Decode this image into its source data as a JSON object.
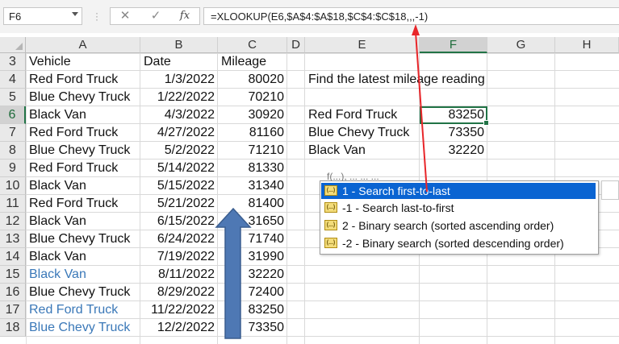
{
  "formula_bar": {
    "name_box": "F6",
    "cancel_icon": "✕",
    "enter_icon": "✓",
    "fx_label": "fx",
    "formula": "=XLOOKUP(E6,$A$4:$A$18,$C$4:$C$18,,,-1)"
  },
  "columns": [
    "A",
    "B",
    "C",
    "D",
    "E",
    "F",
    "G",
    "H"
  ],
  "selected_column": "F",
  "selected_row": "6",
  "rows": [
    {
      "n": "3",
      "a": "Vehicle",
      "b": "Date",
      "c": "Mileage",
      "e": "",
      "f": ""
    },
    {
      "n": "4",
      "a": "Red Ford Truck",
      "b": "1/3/2022",
      "c": "80020",
      "e": "Find the latest mileage reading",
      "f": ""
    },
    {
      "n": "5",
      "a": "Blue Chevy Truck",
      "b": "1/22/2022",
      "c": "70210",
      "e": "",
      "f": ""
    },
    {
      "n": "6",
      "a": "Black Van",
      "b": "4/3/2022",
      "c": "30920",
      "e": "Red Ford Truck",
      "f": "83250"
    },
    {
      "n": "7",
      "a": "Red Ford Truck",
      "b": "4/27/2022",
      "c": "81160",
      "e": "Blue Chevy Truck",
      "f": "73350"
    },
    {
      "n": "8",
      "a": "Blue Chevy Truck",
      "b": "5/2/2022",
      "c": "71210",
      "e": "Black Van",
      "f": "32220"
    },
    {
      "n": "9",
      "a": "Red Ford Truck",
      "b": "5/14/2022",
      "c": "81330",
      "e": "",
      "f": ""
    },
    {
      "n": "10",
      "a": "Black Van",
      "b": "5/15/2022",
      "c": "31340",
      "e": "",
      "f": ""
    },
    {
      "n": "11",
      "a": "Red Ford Truck",
      "b": "5/21/2022",
      "c": "81400",
      "e": "",
      "f": ""
    },
    {
      "n": "12",
      "a": "Black Van",
      "b": "6/15/2022",
      "c": "31650",
      "e": "",
      "f": ""
    },
    {
      "n": "13",
      "a": "Blue Chevy Truck",
      "b": "6/24/2022",
      "c": "71740",
      "e": "",
      "f": ""
    },
    {
      "n": "14",
      "a": "Black Van",
      "b": "7/19/2022",
      "c": "31990",
      "e": "",
      "f": ""
    },
    {
      "n": "15",
      "a": "Black Van",
      "b": "8/11/2022",
      "c": "32220",
      "e": "",
      "f": ""
    },
    {
      "n": "16",
      "a": "Blue Chevy Truck",
      "b": "8/29/2022",
      "c": "72400",
      "e": "",
      "f": ""
    },
    {
      "n": "17",
      "a": "Red Ford Truck",
      "b": "11/22/2022",
      "c": "83250",
      "e": "",
      "f": ""
    },
    {
      "n": "18",
      "a": "Blue Chevy Truck",
      "b": "12/2/2022",
      "c": "73350",
      "e": "",
      "f": ""
    }
  ],
  "highlighted_rows": [
    "15",
    "17",
    "18"
  ],
  "highlight_color": "#3a78b8",
  "autocomplete": {
    "tooltip_fragment": "f(...), ... ... ...",
    "options": [
      {
        "icon": "(...)",
        "label": "1 - Search first-to-last"
      },
      {
        "icon": "(...)",
        "label": "-1 - Search last-to-first"
      },
      {
        "icon": "(...)",
        "label": "2 - Binary search (sorted ascending order)"
      },
      {
        "icon": "(...)",
        "label": "-2 - Binary search (sorted descending order)"
      }
    ],
    "selected_index": 0
  },
  "colors": {
    "selection_green": "#217346",
    "annotation_red": "#e8262a",
    "arrow_fill": "#4e78b4",
    "dropdown_highlight": "#0a64d2"
  }
}
